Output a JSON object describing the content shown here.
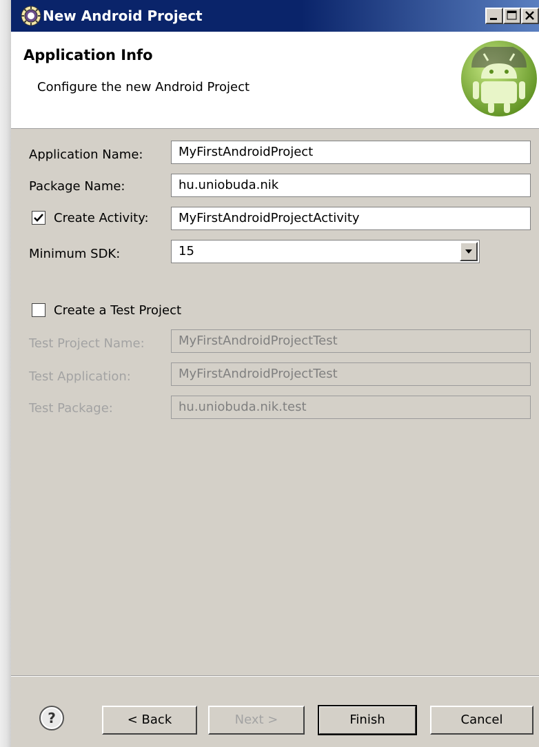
{
  "window": {
    "title": "New Android Project",
    "buttons": [
      "minimize",
      "maximize",
      "close"
    ]
  },
  "header": {
    "title": "Application Info",
    "description": "Configure the new Android Project"
  },
  "form": {
    "application_name": {
      "label": "Application Name:",
      "value": "MyFirstAndroidProject"
    },
    "package_name": {
      "label": "Package Name:",
      "value": "hu.uniobuda.nik"
    },
    "create_activity": {
      "label": "Create Activity:",
      "checked": true,
      "value": "MyFirstAndroidProjectActivity"
    },
    "minimum_sdk": {
      "label": "Minimum SDK:",
      "value": "15"
    },
    "create_test_project": {
      "label": "Create a Test Project",
      "checked": false
    },
    "test_project_name": {
      "label": "Test Project Name:",
      "value": "MyFirstAndroidProjectTest",
      "enabled": false
    },
    "test_application": {
      "label": "Test Application:",
      "value": "MyFirstAndroidProjectTest",
      "enabled": false
    },
    "test_package": {
      "label": "Test Package:",
      "value": "hu.uniobuda.nik.test",
      "enabled": false
    }
  },
  "footer": {
    "back_label": "< Back",
    "next_label": "Next >",
    "finish_label": "Finish",
    "cancel_label": "Cancel"
  },
  "icons": {
    "app": "eclipse-gear-icon",
    "logo": "android-logo-icon",
    "help": "help-icon"
  },
  "colors": {
    "titlebar": "#0a246a",
    "dialog_bg": "#d4d0c8",
    "header_bg": "#ffffff",
    "disabled_text": "#a3a3a3",
    "android_green": "#8bc53f"
  }
}
